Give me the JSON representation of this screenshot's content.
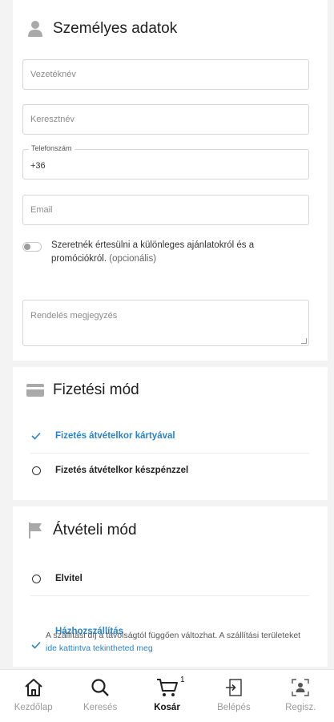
{
  "personal": {
    "title": "Személyes adatok",
    "icon": "person-icon",
    "fields": {
      "last_name": {
        "placeholder": "Vezetéknév"
      },
      "first_name": {
        "placeholder": "Keresztnév"
      },
      "phone": {
        "label": "Telefonszám",
        "value": "+36"
      },
      "email": {
        "placeholder": "Email"
      }
    },
    "consent": {
      "text": "Szeretnék értesülni a különleges ajánlatokról és a promóciókról.",
      "optional": "(opcionális)",
      "enabled": false
    }
  },
  "note": {
    "placeholder": "Rendelés megjegyzés"
  },
  "payment": {
    "title": "Fizetési mód",
    "icon": "credit-card-icon",
    "options": [
      {
        "label": "Fizetés átvételkor kártyával",
        "selected": true
      },
      {
        "label": "Fizetés átvételkor készpénzzel",
        "selected": false
      }
    ]
  },
  "pickup": {
    "title": "Átvételi mód",
    "icon": "flag-icon",
    "options": [
      {
        "label": "Elvitel",
        "selected": false
      },
      {
        "label": "Házhozszállítás",
        "selected": true
      }
    ],
    "delivery_note": "A szállítási díj a távolságtól függően változhat. A szállítási területeket",
    "delivery_link": "ide kattintva tekintheted meg"
  },
  "nav": {
    "items": [
      {
        "label": "Kezdőlap",
        "icon": "home-icon",
        "active": false
      },
      {
        "label": "Keresés",
        "icon": "search-icon",
        "active": false
      },
      {
        "label": "Kosár",
        "icon": "cart-icon",
        "active": true,
        "badge": "1"
      },
      {
        "label": "Belépés",
        "icon": "login-icon",
        "active": false
      },
      {
        "label": "Regisz.",
        "icon": "register-icon",
        "active": false
      }
    ]
  },
  "colors": {
    "accent": "#2a83c9",
    "background": "#f3f3f3"
  }
}
